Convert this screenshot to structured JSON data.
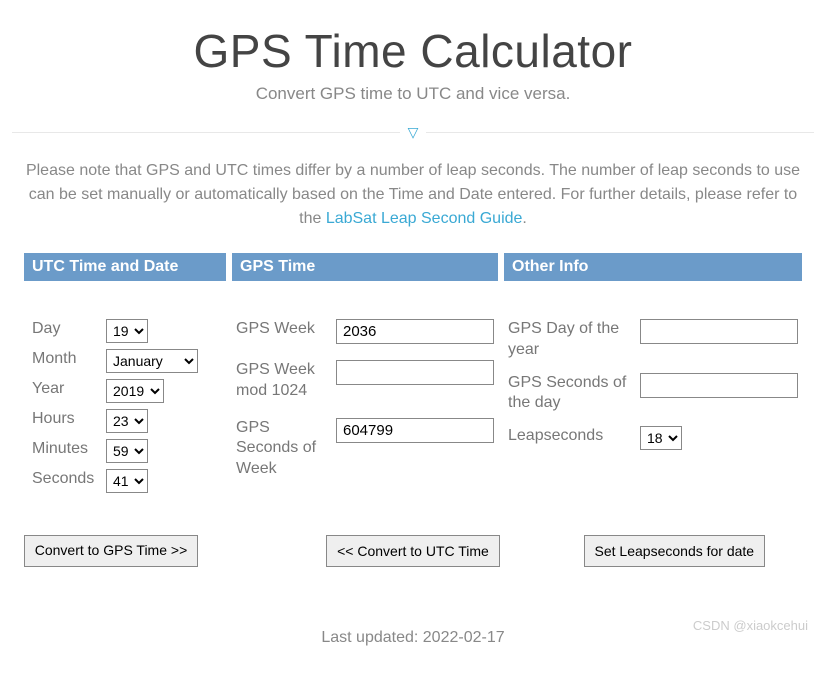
{
  "title": "GPS Time Calculator",
  "subtitle": "Convert GPS time to UTC and vice versa.",
  "note_prefix": "Please note that GPS and UTC times differ by a number of leap seconds. The number of leap seconds to use can be set manually or automatically based on the Time and Date entered. For further details, please refer to the ",
  "note_link": "LabSat Leap Second Guide",
  "note_suffix": ".",
  "panels": {
    "utc": {
      "header": "UTC Time and Date",
      "fields": {
        "day_label": "Day",
        "day_value": "19",
        "month_label": "Month",
        "month_value": "January",
        "year_label": "Year",
        "year_value": "2019",
        "hours_label": "Hours",
        "hours_value": "23",
        "minutes_label": "Minutes",
        "minutes_value": "59",
        "seconds_label": "Seconds",
        "seconds_value": "41"
      }
    },
    "gps": {
      "header": "GPS Time",
      "fields": {
        "week_label": "GPS Week",
        "week_value": "2036",
        "week_mod_label": "GPS Week mod 1024",
        "week_mod_value": "",
        "sow_label": "GPS Seconds of Week",
        "sow_value": "604799"
      }
    },
    "other": {
      "header": "Other Info",
      "fields": {
        "doy_label": "GPS Day of the year",
        "doy_value": "",
        "sod_label": "GPS Seconds of the day",
        "sod_value": "",
        "leap_label": "Leapseconds",
        "leap_value": "18"
      }
    }
  },
  "buttons": {
    "to_gps": "Convert to GPS Time >>",
    "to_utc": "<< Convert to UTC Time",
    "set_leap": "Set Leapseconds for date"
  },
  "last_updated": "Last updated: 2022-02-17",
  "watermark": "CSDN @xiaokcehui"
}
